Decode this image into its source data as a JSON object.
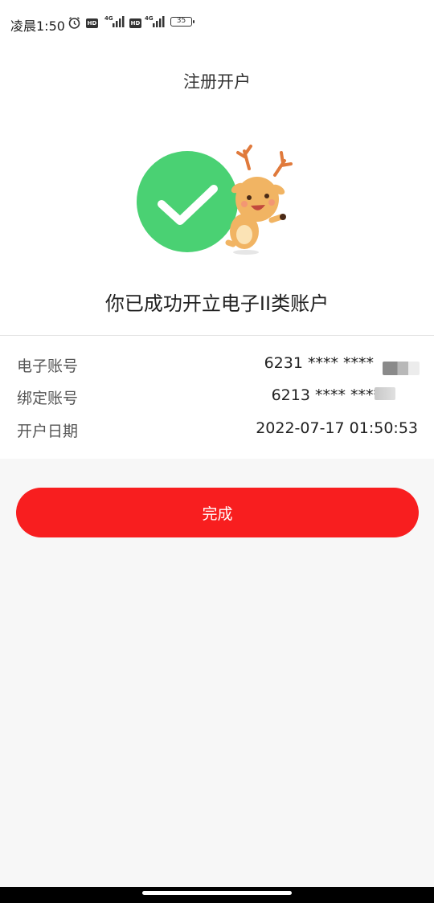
{
  "status_bar": {
    "time": "凌晨1:50",
    "hd1": "HD",
    "hd2": "HD",
    "net1": "4G",
    "net2": "4G",
    "battery": "35"
  },
  "header": {
    "title": "注册开户"
  },
  "success": {
    "message": "你已成功开立电子II类账户",
    "check_color": "#4ad173"
  },
  "details": [
    {
      "label": "电子账号",
      "value": "6231 **** ****"
    },
    {
      "label": "绑定账号",
      "value": "6213 **** ****"
    },
    {
      "label": "开户日期",
      "value": "2022-07-17 01:50:53"
    }
  ],
  "actions": {
    "done_label": "完成",
    "accent_color": "#f81e1f"
  }
}
